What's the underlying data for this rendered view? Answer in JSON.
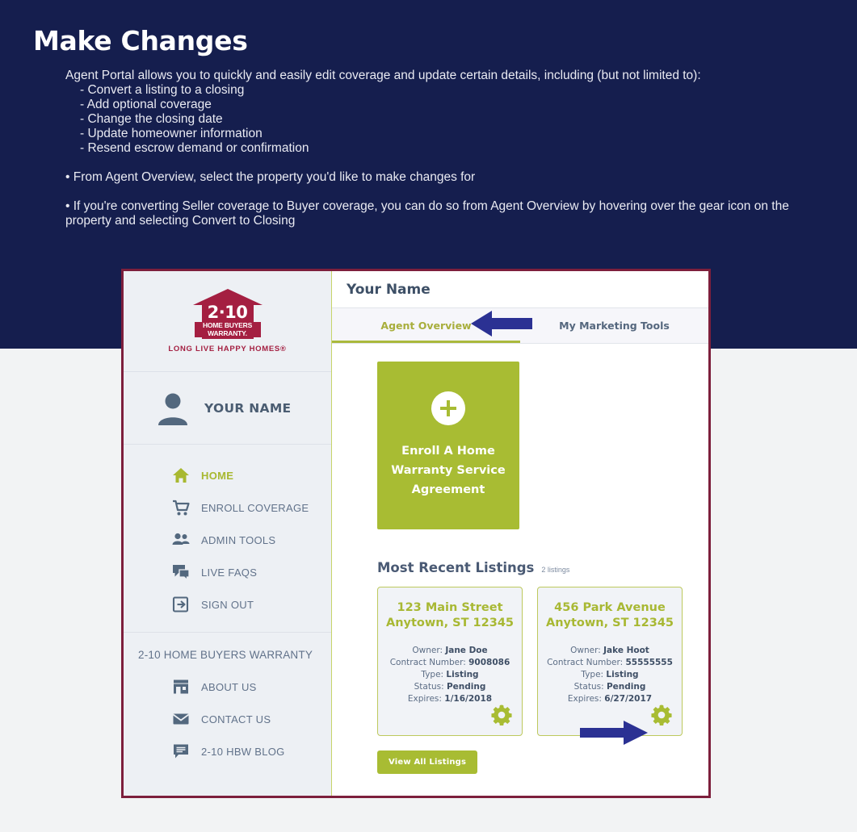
{
  "slide": {
    "title": "Make Changes",
    "lead": "Agent Portal allows you to quickly and easily edit coverage and update certain details, including (but not limited to):",
    "sub_items": [
      "- Convert a listing to a closing",
      "- Add optional coverage",
      "- Change the closing date",
      "- Update homeowner information",
      "- Resend escrow demand or confirmation"
    ],
    "bullet1": "• From Agent Overview, select the property you'd like to make changes for",
    "bullet2": "• If you're converting Seller coverage to Buyer coverage, you can do so from Agent Overview by hovering over the gear icon on the property and selecting Convert to Closing",
    "background_color": "#151e4e",
    "title_color": "#ffffff"
  },
  "app": {
    "frame_border_color": "#7d1f3c",
    "accent_green": "#a8bc33",
    "brand_maroon": "#a41f41",
    "slate": "#55677e",
    "sidebar": {
      "logo": {
        "number": "2·10",
        "line1": "HOME BUYERS",
        "line2": "WARRANTY.",
        "tagline": "LONG LIVE HAPPY HOMES®"
      },
      "user": {
        "name": "YOUR NAME",
        "icon": "user-avatar-icon"
      },
      "nav": [
        {
          "label": "HOME",
          "icon": "home-icon",
          "active": true
        },
        {
          "label": "ENROLL COVERAGE",
          "icon": "cart-icon",
          "active": false
        },
        {
          "label": "ADMIN TOOLS",
          "icon": "people-icon",
          "active": false
        },
        {
          "label": "LIVE FAQS",
          "icon": "chat-bubbles-icon",
          "active": false
        },
        {
          "label": "SIGN OUT",
          "icon": "sign-out-icon",
          "active": false
        }
      ],
      "footer_heading": "2-10 HOME BUYERS WARRANTY",
      "footer_nav": [
        {
          "label": "ABOUT US",
          "icon": "storefront-icon"
        },
        {
          "label": "CONTACT US",
          "icon": "envelope-icon"
        },
        {
          "label": "2-10 HBW BLOG",
          "icon": "blog-icon"
        }
      ]
    },
    "main": {
      "header_title": "Your Name",
      "tabs": [
        {
          "label": "Agent Overview",
          "active": true
        },
        {
          "label": "My Marketing Tools",
          "active": false
        }
      ],
      "enroll_card": {
        "icon": "plus-icon",
        "line1": "Enroll A Home",
        "line2": "Warranty Service",
        "line3": "Agreement"
      },
      "listings": {
        "heading": "Most Recent Listings",
        "count_label": "2 listings",
        "cards": [
          {
            "street": "123 Main Street",
            "city": "Anytown, ST 12345",
            "owner_label": "Owner:",
            "owner": "Jane Doe",
            "contract_label": "Contract Number:",
            "contract": "9008086",
            "type_label": "Type:",
            "type": "Listing",
            "status_label": "Status:",
            "status": "Pending",
            "expires_label": "Expires:",
            "expires": "1/16/2018",
            "gear_icon": "gear-icon"
          },
          {
            "street": "456 Park Avenue",
            "city": "Anytown, ST 12345",
            "owner_label": "Owner:",
            "owner": "Jake Hoot",
            "contract_label": "Contract Number:",
            "contract": "55555555",
            "type_label": "Type:",
            "type": "Listing",
            "status_label": "Status:",
            "status": "Pending",
            "expires_label": "Expires:",
            "expires": "6/27/2017",
            "gear_icon": "gear-icon"
          }
        ],
        "view_all_label": "View All Listings"
      }
    }
  },
  "annotations": {
    "arrow_color": "#2b3193",
    "arrow_tab": "arrow-pointing-left-at-agent-overview-tab",
    "arrow_gear": "arrow-pointing-right-at-gear-icon"
  }
}
